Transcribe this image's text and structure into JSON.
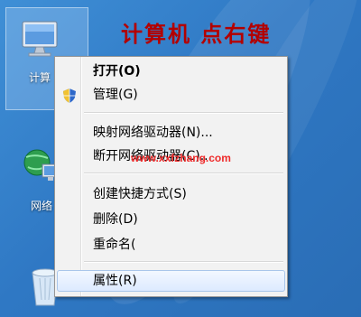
{
  "annotation": {
    "caption": "计算机  点右键"
  },
  "desktop_icons": [
    {
      "label": "计算",
      "icon": "computer-icon"
    },
    {
      "label": "网络",
      "icon": "network-icon"
    },
    {
      "label": "",
      "icon": "recycle-bin-icon"
    }
  ],
  "context_menu": {
    "items": [
      {
        "label": "打开(O)",
        "bold": true
      },
      {
        "label": "管理(G)",
        "icon": "shield-icon"
      },
      {
        "label": "映射网络驱动器(N)..."
      },
      {
        "label": "断开网络驱动器(C)..."
      },
      {
        "label": "创建快捷方式(S)"
      },
      {
        "label": "删除(D)"
      },
      {
        "label": "重命名("
      },
      {
        "label": "属性(R)",
        "highlighted": true
      }
    ]
  },
  "watermark": "www.xxfzhang.com",
  "colors": {
    "caption": "#b30000",
    "watermark": "#ef2b2b",
    "desktop": "#2f78c4",
    "menu_bg": "#f2f2f2"
  }
}
